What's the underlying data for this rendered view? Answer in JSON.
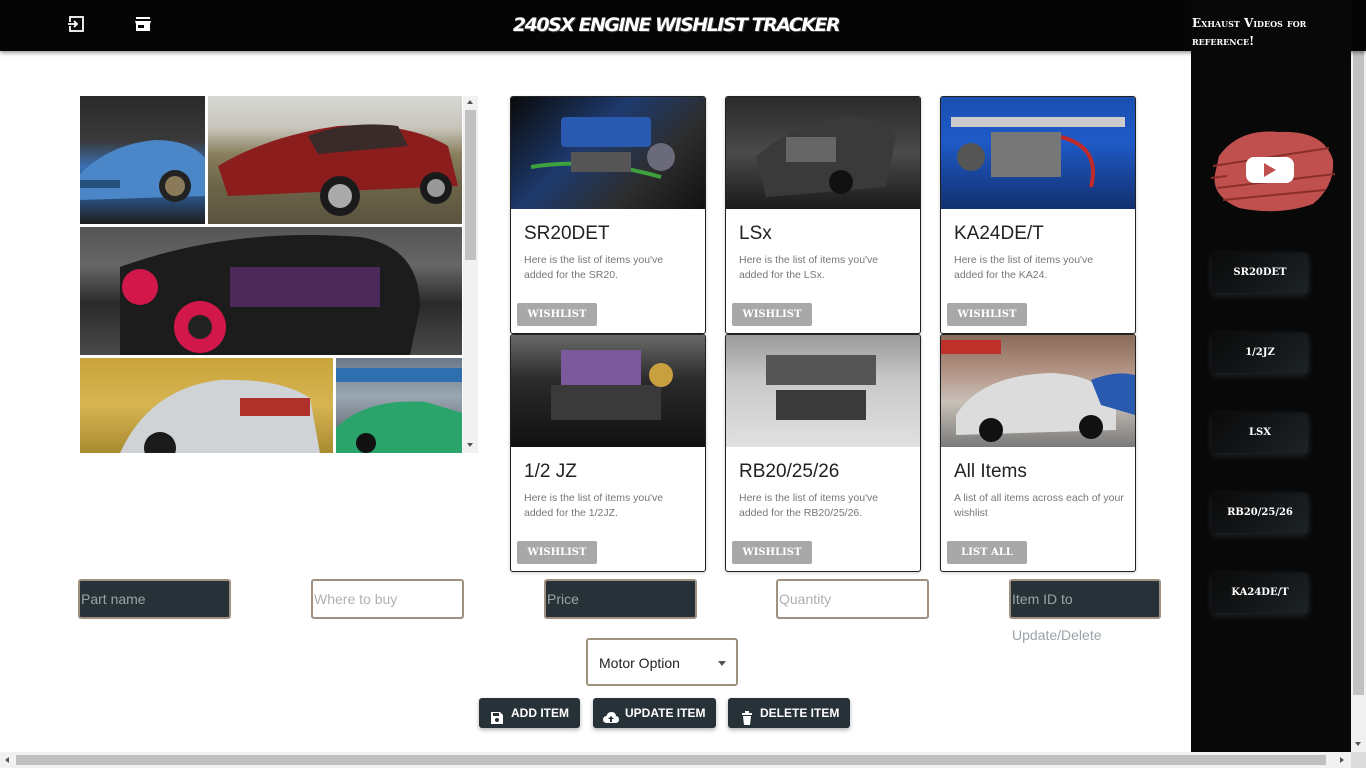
{
  "header": {
    "title": "240sx Engine Wishlist Tracker",
    "icons": [
      "login-icon",
      "store-icon"
    ]
  },
  "sidebar": {
    "title": "Exhaust Videos for reference!",
    "logo": "youtube-icon",
    "links": [
      "SR20DET",
      "1/2JZ",
      "LSX",
      "RB20/25/26",
      "KA24DE/T"
    ]
  },
  "cards": [
    {
      "title": "SR20DET",
      "desc": "Here is the list of items you've added for the SR20.",
      "button": "WISHLIST"
    },
    {
      "title": "LSx",
      "desc": "Here is the list of items you've added for the LSx.",
      "button": "WISHLIST"
    },
    {
      "title": "KA24DE/T",
      "desc": "Here is the list of items you've added for the KA24.",
      "button": "WISHLIST"
    },
    {
      "title": "1/2 JZ",
      "desc": "Here is the list of items you've added for the 1/2JZ.",
      "button": "WISHLIST"
    },
    {
      "title": "RB20/25/26",
      "desc": "Here is the list of items you've added for the RB20/25/26.",
      "button": "WISHLIST"
    },
    {
      "title": "All Items",
      "desc": "A list of all items across each of your wishlist",
      "button": "LIST ALL"
    }
  ],
  "form": {
    "part_name": "Part name",
    "where_to_buy": "Where to buy",
    "price": "Price",
    "quantity": "Quantity",
    "item_id": "Item ID to Update/Delete",
    "motor_option": "Motor Option"
  },
  "actions": {
    "add": "ADD ITEM",
    "update": "UPDATE ITEM",
    "delete": "DELETE ITEM"
  },
  "colors": {
    "topbar": "#050505",
    "sidebar": "#080808",
    "dark_field": "#263238",
    "card_button": "#a8a8a8",
    "youtube_red": "#c0504d"
  }
}
